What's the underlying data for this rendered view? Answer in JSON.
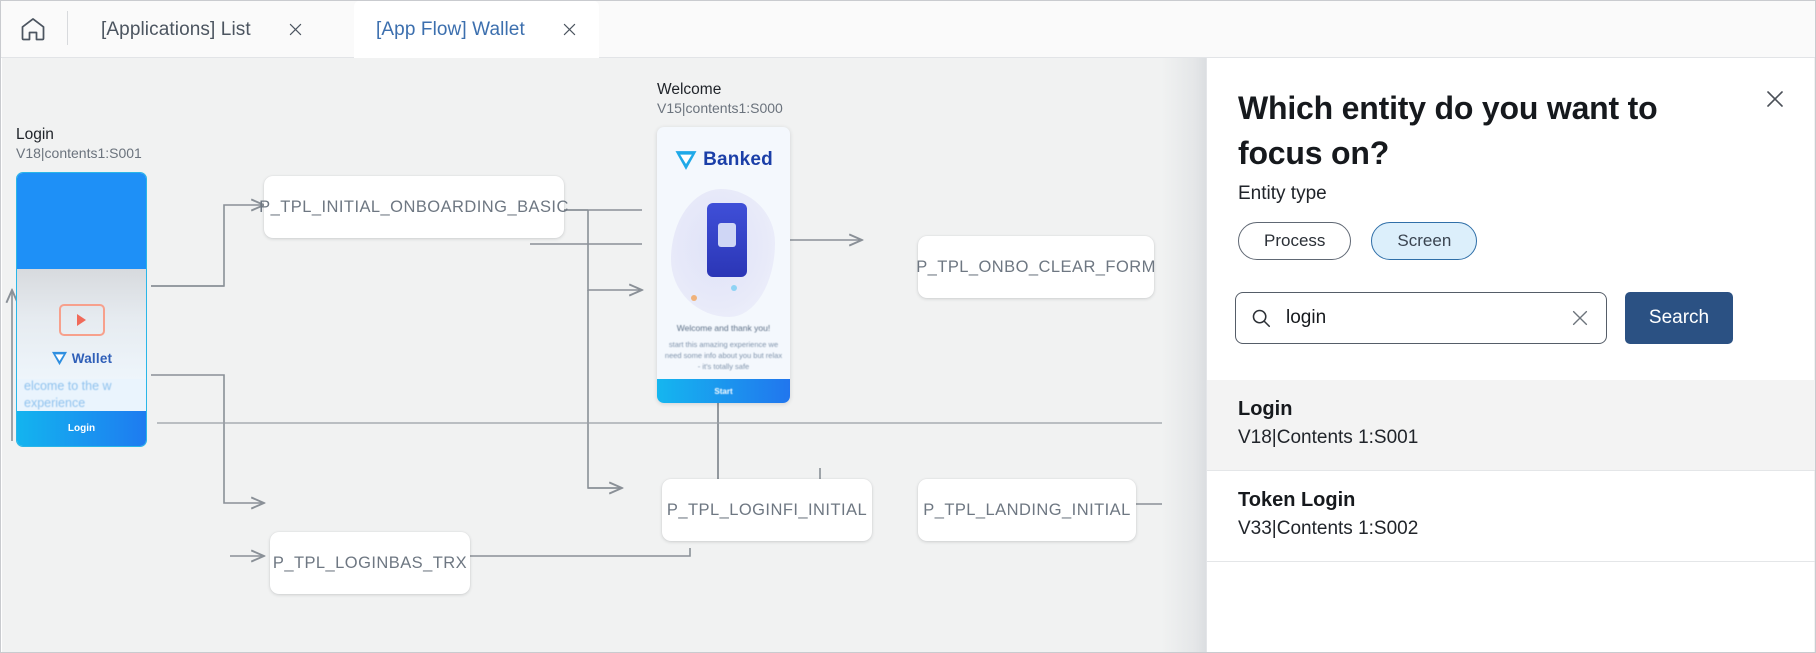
{
  "tabbar": {
    "home_icon": "home-icon",
    "tabs": [
      {
        "label": "[Applications] List",
        "active": false
      },
      {
        "label": "[App Flow] Wallet",
        "active": true
      }
    ],
    "close_icon": "close-icon"
  },
  "canvas": {
    "screens": [
      {
        "title": "Login",
        "id": "V18|contents1:S001",
        "preview": {
          "brand": "Wallet",
          "body": "elcome to the\nw experience",
          "button": "Login"
        }
      },
      {
        "title": "Welcome",
        "id": "V15|contents1:S000",
        "preview": {
          "brand": "Banked",
          "title": "Welcome and thank you!",
          "body": "start this amazing experience we need some\ninfo about you but relax - it's totally safe",
          "button": "Start"
        }
      }
    ],
    "processes": [
      {
        "label": "P_TPL_INITIAL_ONBOARDING_BASIC"
      },
      {
        "label": "P_TPL_ONBO_CLEAR_FORM"
      },
      {
        "label": "P_TPL_LOGINFI_INITIAL"
      },
      {
        "label": "P_TPL_LANDING_INITIAL"
      },
      {
        "label": "P_TPL_LOGINBAS_TRX"
      }
    ]
  },
  "panel": {
    "title": "Which entity do you want to focus on?",
    "close_icon": "close-icon",
    "entity_type_label": "Entity type",
    "entity_types": [
      {
        "label": "Process",
        "selected": false
      },
      {
        "label": "Screen",
        "selected": true
      }
    ],
    "search": {
      "icon": "search-icon",
      "value": "login",
      "placeholder": "Search",
      "clear_icon": "close-icon",
      "button_label": "Search"
    },
    "results": [
      {
        "name": "Login",
        "id": "V18|Contents 1:S001",
        "highlighted": true
      },
      {
        "name": "Token Login",
        "id": "V33|Contents 1:S002",
        "highlighted": false
      }
    ]
  },
  "colors": {
    "accent_blue": "#3c6fae",
    "button_navy": "#2b5183",
    "chip_selected_bg": "#dceffb",
    "canvas_bg": "#f1f2f2",
    "node_text": "#6e7782"
  }
}
